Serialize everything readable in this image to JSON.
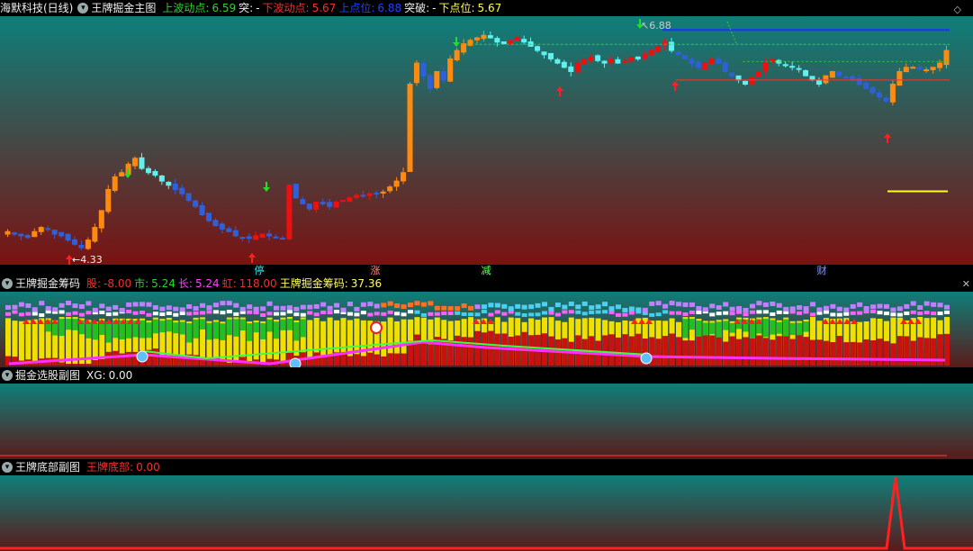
{
  "header": {
    "stock_name": "海默科技(日线)",
    "indicator": "王牌掘金主图",
    "up_label": "上波动点:",
    "up_value": "6.59",
    "tu_label": "突:",
    "tu_value": "-",
    "down_label": "下波动点:",
    "down_value": "5.67",
    "upper_label": "上点位:",
    "upper_value": "6.88",
    "break_label": "突破:",
    "break_value": "-",
    "lower_label": "下点位:",
    "lower_value": "5.67"
  },
  "panel2_header": {
    "title": "王牌掘金筹码",
    "gu_label": "股:",
    "gu_value": "-8.00",
    "shi_label": "市:",
    "shi_value": "5.24",
    "chang_label": "长:",
    "chang_value": "5.24",
    "hong_label": "虹:",
    "hong_value": "118.00",
    "main_label": "王牌掘金筹码:",
    "main_value": "37.36"
  },
  "panel3_header": {
    "title": "掘金选股副图",
    "xg_label": "XG:",
    "xg_value": "0.00"
  },
  "panel4_header": {
    "title": "王牌底部副图",
    "label": "王牌底部:",
    "value": "0.00"
  },
  "colors": {
    "gradient_top": "#0e7f7a",
    "gradient_bottom": "#7a1212",
    "up_orange": "#ff8a10",
    "up_red": "#ee1010",
    "down_cyan": "#60f0f0",
    "down_blue": "#3060d8",
    "yellow": "#f0e000",
    "green": "#20c020",
    "magenta": "#ff30ff"
  },
  "chart_data": [
    {
      "type": "candlestick",
      "title": "王牌掘金主图",
      "annotations": [
        {
          "text": "4.33",
          "kind": "low"
        },
        {
          "text": "6.88",
          "kind": "high"
        }
      ],
      "event_labels": [
        "停",
        "涨",
        "减",
        "财"
      ],
      "horizontal_levels": {
        "upper": 6.88,
        "up_wave": 6.59,
        "lower": 5.67,
        "down_wave": 5.67
      },
      "close": [
        4.55,
        4.52,
        4.5,
        4.48,
        4.55,
        4.6,
        4.58,
        4.52,
        4.5,
        4.45,
        4.4,
        4.36,
        4.45,
        4.6,
        4.8,
        5.05,
        5.2,
        5.25,
        5.35,
        5.42,
        5.3,
        5.25,
        5.22,
        5.15,
        5.1,
        5.05,
        5.0,
        4.92,
        4.85,
        4.75,
        4.68,
        4.62,
        4.58,
        4.55,
        4.5,
        4.48,
        4.47,
        4.5,
        4.52,
        4.5,
        4.48,
        4.47,
        5.1,
        4.95,
        4.88,
        4.82,
        4.9,
        4.88,
        4.85,
        4.9,
        4.92,
        4.95,
        4.98,
        4.98,
        5.0,
        5.0,
        5.02,
        5.08,
        5.15,
        5.25,
        6.3,
        6.55,
        6.4,
        6.25,
        6.45,
        6.35,
        6.6,
        6.7,
        6.78,
        6.82,
        6.85,
        6.88,
        6.85,
        6.8,
        6.78,
        6.82,
        6.85,
        6.8,
        6.75,
        6.7,
        6.65,
        6.6,
        6.55,
        6.5,
        6.45,
        6.55,
        6.6,
        6.62,
        6.58,
        6.55,
        6.6,
        6.55,
        6.58,
        6.62,
        6.6,
        6.65,
        6.7,
        6.75,
        6.8,
        6.7,
        6.65,
        6.6,
        6.55,
        6.5,
        6.55,
        6.6,
        6.55,
        6.45,
        6.4,
        6.35,
        6.3,
        6.38,
        6.45,
        6.55,
        6.6,
        6.55,
        6.52,
        6.5,
        6.48,
        6.4,
        6.35,
        6.3,
        6.4,
        6.45,
        6.4,
        6.38,
        6.35,
        6.3,
        6.25,
        6.2,
        6.15,
        6.1,
        6.3,
        6.45,
        6.5,
        6.5,
        6.48,
        6.47,
        6.5,
        6.55,
        6.7
      ],
      "chips_panel": {
        "title": "王牌掘金筹码",
        "values": {
          "股": -8.0,
          "市": 5.24,
          "长": 5.24,
          "虹": 118.0,
          "王牌掘金筹码": 37.36
        }
      },
      "xg_panel": {
        "title": "掘金选股副图",
        "XG": 0.0
      },
      "bottom_panel": {
        "title": "王牌底部副图",
        "王牌底部": 0.0
      }
    }
  ]
}
